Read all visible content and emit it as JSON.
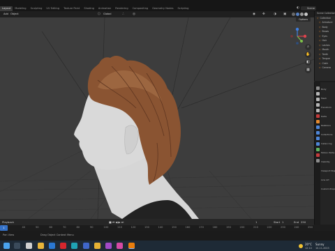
{
  "workspace_tabs": [
    "Layout",
    "Modeling",
    "Sculpting",
    "UV Editing",
    "Texture Paint",
    "Shading",
    "Animation",
    "Rendering",
    "Compositing",
    "Geometry Nodes",
    "Scripting"
  ],
  "active_tab": "Layout",
  "scene": {
    "label": "Scene"
  },
  "viewport_header": {
    "mode_btn1": "Add",
    "mode_btn2": "Object",
    "transform": "Global",
    "options": "Options"
  },
  "outliner": {
    "title": "Scene Collection",
    "rows": [
      "Collection",
      "Armature",
      "Body",
      "Brows",
      "Eyes",
      "Hair",
      "Lashes",
      "Mouth",
      "Teeth",
      "Tongue",
      "Cloth",
      "Camera"
    ]
  },
  "properties": {
    "object_name": "Body",
    "rows": [
      "Body",
      "Mesh",
      "Transform",
      "Delta",
      "Relations",
      "Collections",
      "Instancing",
      "Motion Paths",
      "Visibility",
      "Viewport Display",
      "Line Art",
      "Custom Props"
    ]
  },
  "timeline": {
    "playback": "Playback",
    "keying": "Keying",
    "view": "View",
    "marker": "Marker",
    "current_frame": "1",
    "start_label": "Start",
    "start": "1",
    "end_label": "End",
    "end": "250",
    "ruler": [
      "0",
      "40",
      "50",
      "60",
      "70",
      "80",
      "90",
      "100",
      "110",
      "120",
      "130",
      "140",
      "150",
      "160",
      "170",
      "180",
      "190",
      "200",
      "210",
      "220",
      "230",
      "240",
      "250"
    ]
  },
  "status": {
    "left": "Pan View",
    "mid": "Drag Object Context Menu"
  },
  "taskbar": {
    "temperature": "20°C",
    "weather": "Sunny",
    "time": "12:14",
    "date": "10-11-2023"
  },
  "colors": {
    "accent": "#3572c8",
    "hair": "#8a5432",
    "skin": "#d9d9d9",
    "viewport": "#3d3d3d"
  }
}
